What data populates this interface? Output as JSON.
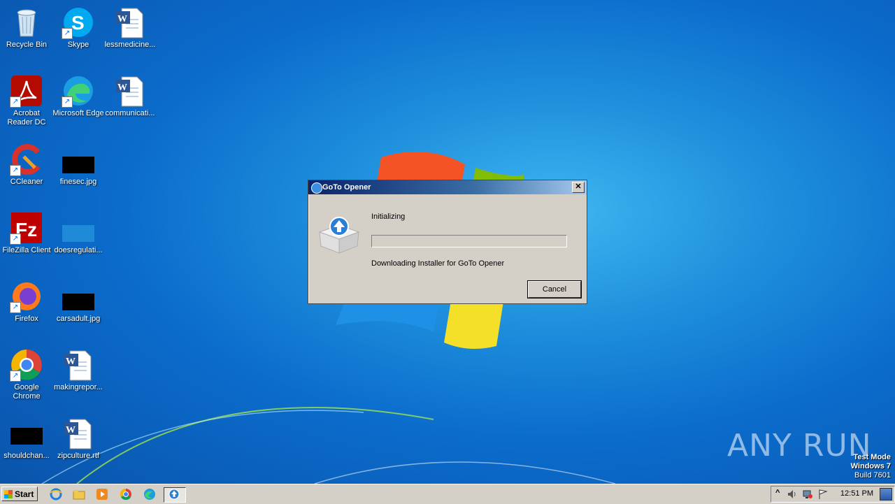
{
  "desktop": {
    "icons": [
      {
        "label": "Recycle Bin"
      },
      {
        "label": "Skype"
      },
      {
        "label": "lessmedicine..."
      },
      {
        "label": "Acrobat Reader DC"
      },
      {
        "label": "Microsoft Edge"
      },
      {
        "label": "communicati..."
      },
      {
        "label": "CCleaner"
      },
      {
        "label": "finesec.jpg"
      },
      {
        "label": "FileZilla Client"
      },
      {
        "label": "doesregulati..."
      },
      {
        "label": "Firefox"
      },
      {
        "label": "carsadult.jpg"
      },
      {
        "label": "Google Chrome"
      },
      {
        "label": "makingrepor..."
      },
      {
        "label": "shouldchan..."
      },
      {
        "label": "zipculture.rtf"
      }
    ]
  },
  "dialog": {
    "title": "GoTo Opener",
    "close_glyph": "✕",
    "status": "Initializing",
    "progress": 0,
    "message": "Downloading Installer for GoTo Opener",
    "cancel_label": "Cancel"
  },
  "taskbar": {
    "start_label": "Start",
    "clock": "12:51 PM",
    "tray_arrow": "^"
  },
  "watermark": {
    "line1": "Test Mode",
    "line2": "Windows 7",
    "line3": "Build 7601",
    "brand": "ANY RUN"
  },
  "colors": {
    "titlebar_start": "#0a246a",
    "titlebar_end": "#a6caf0",
    "dialog_bg": "#d4d0c8"
  }
}
